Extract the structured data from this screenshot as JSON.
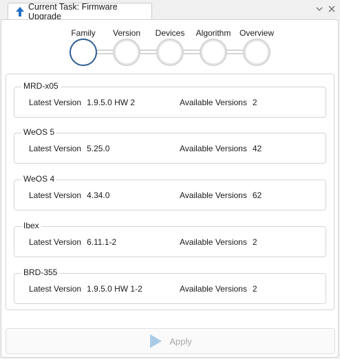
{
  "tab": {
    "title": "Current Task: Firmware Upgrade",
    "icon": "upload-arrow-icon"
  },
  "window_controls": [
    "chevron-down-icon",
    "close-icon"
  ],
  "steps": [
    {
      "label": "Family",
      "active": true
    },
    {
      "label": "Version",
      "active": false
    },
    {
      "label": "Devices",
      "active": false
    },
    {
      "label": "Algorithm",
      "active": false
    },
    {
      "label": "Overview",
      "active": false
    }
  ],
  "families": [
    {
      "name": "MRD-x05",
      "latest_label": "Latest Version",
      "latest": "1.9.5.0 HW 2",
      "available_label": "Available Versions",
      "available": "2"
    },
    {
      "name": "WeOS 5",
      "latest_label": "Latest Version",
      "latest": "5.25.0",
      "available_label": "Available Versions",
      "available": "42"
    },
    {
      "name": "WeOS 4",
      "latest_label": "Latest Version",
      "latest": "4.34.0",
      "available_label": "Available Versions",
      "available": "62"
    },
    {
      "name": "Ibex",
      "latest_label": "Latest Version",
      "latest": "6.11.1-2",
      "available_label": "Available Versions",
      "available": "2"
    },
    {
      "name": "BRD-355",
      "latest_label": "Latest Version",
      "latest": "1.9.5.0 HW 1-2",
      "available_label": "Available Versions",
      "available": "2"
    }
  ],
  "apply": {
    "label": "Apply",
    "enabled": false
  },
  "colors": {
    "accent": "#2d5c91",
    "tab_icon": "#1f6fc4",
    "disabled": "#a8a8a8",
    "apply_icon": "#a9cbe8"
  }
}
